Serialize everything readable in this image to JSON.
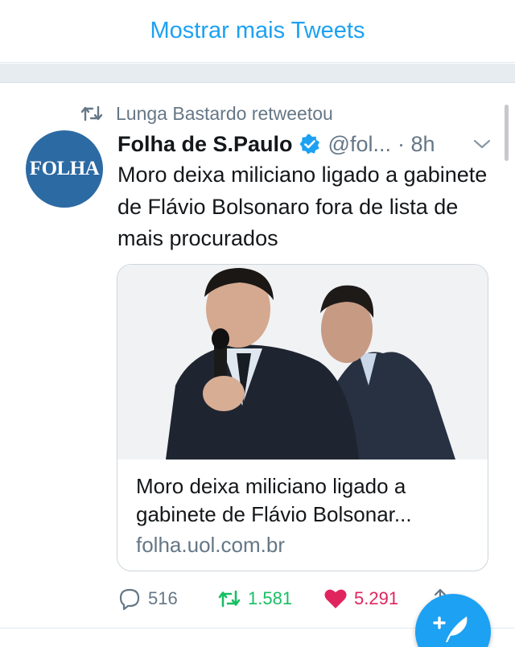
{
  "show_more": {
    "label": "Mostrar mais Tweets"
  },
  "tweet": {
    "retweeted_by": "Lunga Bastardo retweetou",
    "avatar_text": "FOLHA",
    "author_name": "Folha de S.Paulo",
    "author_handle": "@fol...",
    "time": "· 8h",
    "text": "Moro deixa miliciano ligado a gabinete de Flávio Bolsonaro fora de lista de mais procurados",
    "card": {
      "title": "Moro deixa miliciano ligado a gabinete de Flávio Bolsonar...",
      "domain": "folha.uol.com.br"
    },
    "actions": {
      "replies": "516",
      "retweets": "1.581",
      "likes": "5.291"
    }
  },
  "icons": {
    "retweet": "retweet-icon",
    "verified": "verified-badge-icon",
    "chevron": "chevron-down-icon",
    "reply": "reply-icon",
    "like": "heart-icon",
    "share": "share-icon",
    "compose": "compose-tweet-icon"
  },
  "colors": {
    "accent": "#1da1f2",
    "retweet_green": "#17bf63",
    "like_red": "#e0245e",
    "secondary_text": "#657786",
    "avatar_blue": "#2c6aa3"
  }
}
